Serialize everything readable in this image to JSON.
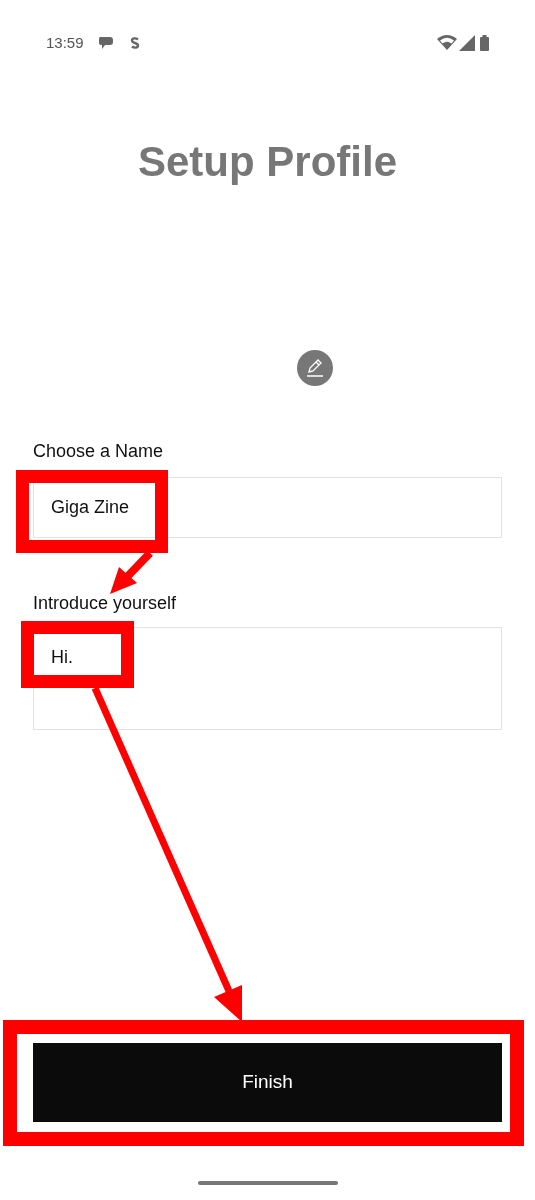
{
  "status_bar": {
    "time": "13:59"
  },
  "title": "Setup Profile",
  "fields": [
    {
      "kind": "text",
      "label": "Choose a Name",
      "value": "Giga Zine"
    },
    {
      "kind": "multiline",
      "label": "Introduce yourself",
      "value": "Hi."
    }
  ],
  "button": {
    "label": "Finish"
  }
}
